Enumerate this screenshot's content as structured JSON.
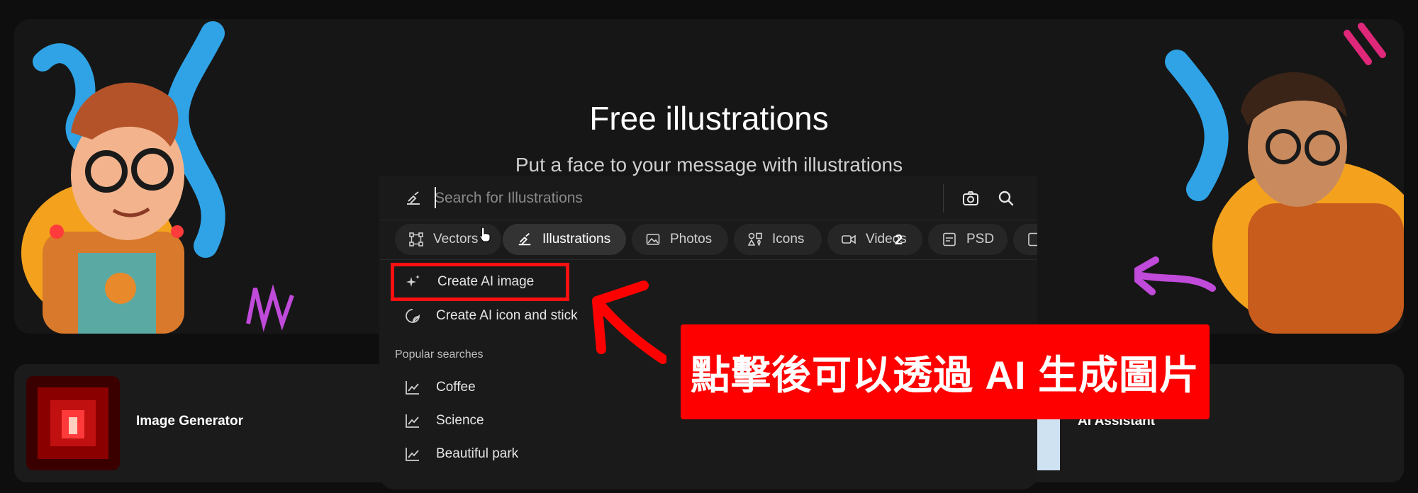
{
  "hero": {
    "title": "Free illustrations",
    "subtitle": "Put a face to your message with illustrations"
  },
  "search": {
    "placeholder": "Search for Illustrations",
    "value": ""
  },
  "chips": [
    {
      "label": "Vectors",
      "icon": "vector-nodes-icon",
      "active": false
    },
    {
      "label": "Illustrations",
      "icon": "illustration-brush-icon",
      "active": true
    },
    {
      "label": "Photos",
      "icon": "photo-icon",
      "active": false
    },
    {
      "label": "Icons",
      "icon": "shapes-icon",
      "active": false
    },
    {
      "label": "Videos",
      "icon": "video-camera-icon",
      "active": false
    },
    {
      "label": "PSD",
      "icon": "psd-file-icon",
      "active": false
    }
  ],
  "menu": {
    "create_ai_image": "Create AI image",
    "create_ai_icon": "Create AI icon and stick"
  },
  "popular": {
    "label": "Popular searches",
    "items": [
      "Coffee",
      "Science",
      "Beautiful park"
    ]
  },
  "cards": {
    "left_label": "Image Generator",
    "right_label": "AI Assistant"
  },
  "annotation": {
    "callout_text": "點擊後可以透過 AI 生成圖片",
    "badge": "2",
    "color": "#ff0000"
  }
}
